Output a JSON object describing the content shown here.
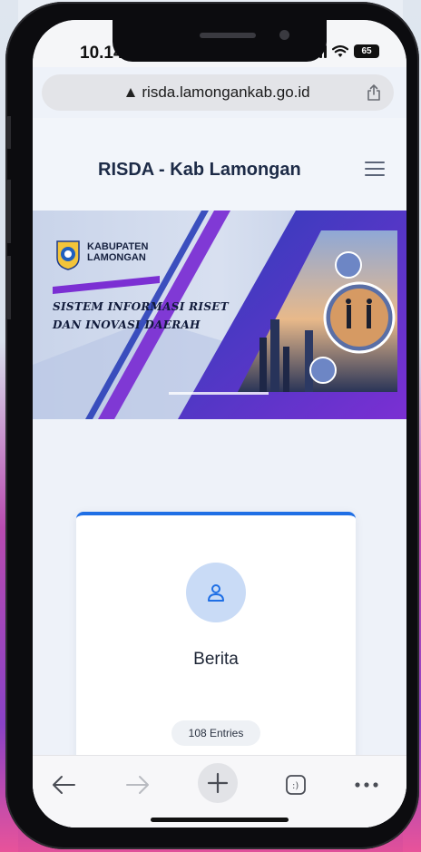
{
  "status": {
    "time": "10.14",
    "battery": "65"
  },
  "browser": {
    "url": "risda.lamongankab.go.id"
  },
  "header": {
    "title": "RISDA - Kab Lamongan"
  },
  "banner": {
    "logo_line1": "KABUPATEN",
    "logo_line2": "LAMONGAN",
    "title_line1": "SISTEM INFORMASI RISET",
    "title_line2": "DAN INOVASI DAERAH"
  },
  "card": {
    "title": "Berita",
    "badge": "108 Entries"
  },
  "colors": {
    "accent": "#1f6fe5",
    "title": "#1d2b47",
    "banner_purple": "#7b2fd3",
    "banner_blue": "#2a3fb8"
  },
  "icons": [
    "lock-icon",
    "share-icon",
    "menu-icon",
    "person-icon",
    "back-icon",
    "forward-icon",
    "plus-icon",
    "tabs-icon",
    "more-icon"
  ]
}
